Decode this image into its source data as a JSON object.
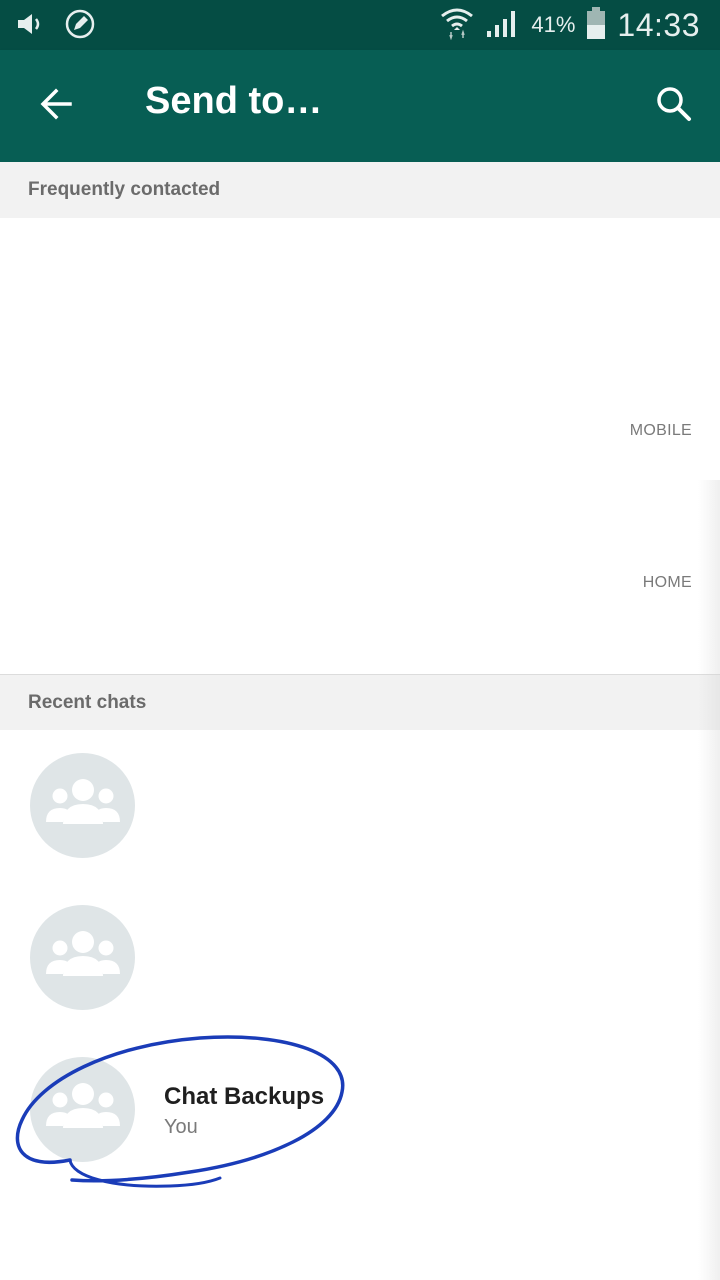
{
  "status_bar": {
    "battery_percent": "41%",
    "time": "14:33",
    "icons": [
      "volume-icon",
      "edit-circle-icon",
      "wifi-icon",
      "signal-icon",
      "battery-icon"
    ]
  },
  "app_bar": {
    "title": "Send to…",
    "back_icon": "arrow-left-icon",
    "search_icon": "search-icon",
    "background": "#075e54"
  },
  "frequently_contacted": {
    "header": "Frequently contacted",
    "items": [
      {
        "type_label": "MOBILE"
      },
      {
        "type_label": "HOME"
      }
    ]
  },
  "recent_chats": {
    "header": "Recent chats",
    "items": [
      {
        "name": "",
        "subtitle": "",
        "avatar_icon": "group-icon"
      },
      {
        "name": "",
        "subtitle": "",
        "avatar_icon": "group-icon"
      },
      {
        "name": "Chat Backups",
        "subtitle": "You",
        "avatar_icon": "group-icon"
      }
    ]
  },
  "colors": {
    "status_bar": "#054d44",
    "accent": "#075e54",
    "annotation": "#1a3cb8"
  }
}
